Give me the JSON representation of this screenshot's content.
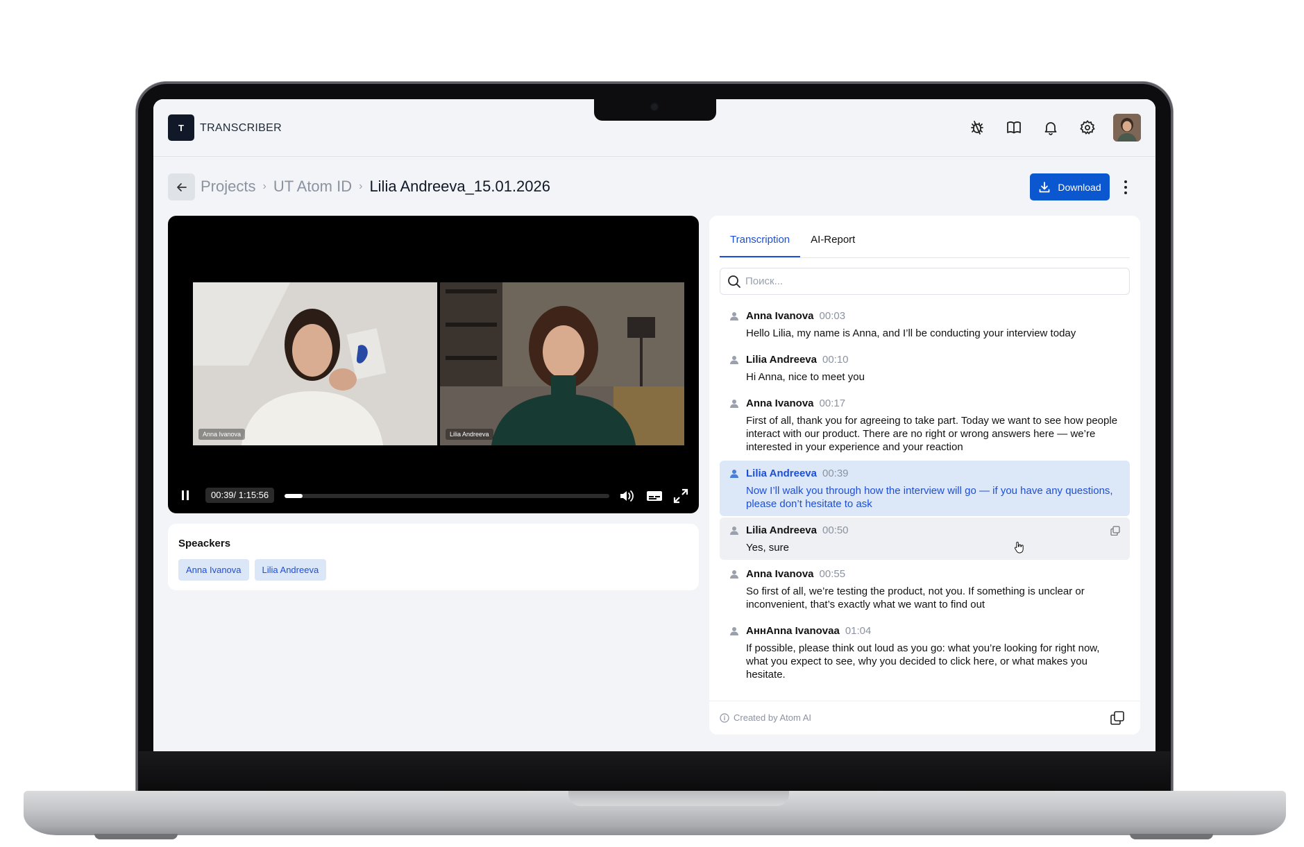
{
  "app": {
    "logo_letter": "T",
    "name": "TRANSCRIBER"
  },
  "header_icons": [
    "bug-icon",
    "book-icon",
    "bell-icon",
    "gear-icon",
    "avatar"
  ],
  "breadcrumb": {
    "items": [
      "Projects",
      "UT Atom ID",
      "Lilia Andreeva_15.01.2026"
    ]
  },
  "actions": {
    "download_label": "Download"
  },
  "player": {
    "participants": [
      "Anna Ivanova",
      "Lilia Andreeva"
    ],
    "time_label": "00:39/ 1:15:56",
    "progress": 0.056
  },
  "speakers": {
    "title": "Speackers",
    "chips": [
      "Anna Ivanova",
      "Lilia Andreeva"
    ]
  },
  "panel": {
    "tabs": [
      "Transcription",
      "AI-Report"
    ],
    "active_tab": "Transcription",
    "search_placeholder": "Поиск...",
    "entries": [
      {
        "speaker": "Anna Ivanova",
        "time": "00:03",
        "text": "Hello Lilia, my name is Anna, and I’ll be conducting your interview today"
      },
      {
        "speaker": "Lilia Andreeva",
        "time": "00:10",
        "text": "Hi Anna, nice to meet you"
      },
      {
        "speaker": "Anna Ivanova",
        "time": "00:17",
        "text": "First of all, thank you for agreeing to take part. Today we want to see how people interact with our product. There are no right or wrong answers here — we’re interested in your experience and your reaction"
      },
      {
        "speaker": "Lilia Andreeva",
        "time": "00:39",
        "text": "Now I’ll walk you through how the interview will go — if you have any questions, please don’t hesitate to ask"
      },
      {
        "speaker": "Lilia Andreeva",
        "time": "00:50",
        "text": "Yes, sure"
      },
      {
        "speaker": "Anna Ivanova",
        "time": "00:55",
        "text": "So first of all, we’re testing the product, not you. If something is unclear or inconvenient, that’s exactly what we want to find out"
      },
      {
        "speaker": "АннAnna Ivanovaa",
        "time": "01:04",
        "text": "If possible, please think out loud as you go: what you’re looking for right now, what you expect to see, why you decided to click here, or what makes you hesitate."
      }
    ],
    "footer_note": "Created by Atom AI"
  },
  "colors": {
    "accent": "#0b57d0",
    "highlight": "#dce8f8",
    "chip_bg": "#dbe7f6"
  }
}
